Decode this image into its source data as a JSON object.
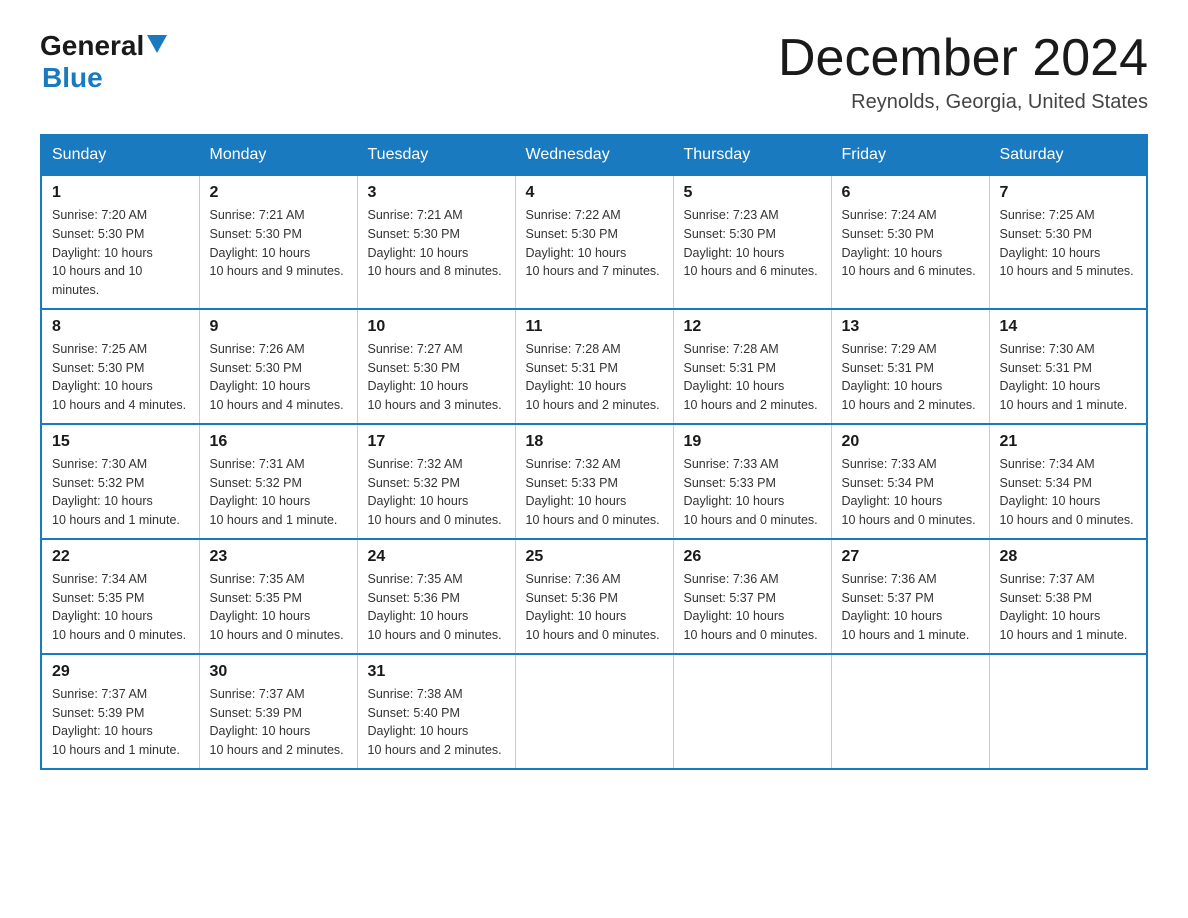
{
  "header": {
    "logo_general": "General",
    "logo_blue": "Blue",
    "month_title": "December 2024",
    "location": "Reynolds, Georgia, United States"
  },
  "days_of_week": [
    "Sunday",
    "Monday",
    "Tuesday",
    "Wednesday",
    "Thursday",
    "Friday",
    "Saturday"
  ],
  "weeks": [
    [
      {
        "num": "1",
        "sunrise": "7:20 AM",
        "sunset": "5:30 PM",
        "daylight": "10 hours and 10 minutes."
      },
      {
        "num": "2",
        "sunrise": "7:21 AM",
        "sunset": "5:30 PM",
        "daylight": "10 hours and 9 minutes."
      },
      {
        "num": "3",
        "sunrise": "7:21 AM",
        "sunset": "5:30 PM",
        "daylight": "10 hours and 8 minutes."
      },
      {
        "num": "4",
        "sunrise": "7:22 AM",
        "sunset": "5:30 PM",
        "daylight": "10 hours and 7 minutes."
      },
      {
        "num": "5",
        "sunrise": "7:23 AM",
        "sunset": "5:30 PM",
        "daylight": "10 hours and 6 minutes."
      },
      {
        "num": "6",
        "sunrise": "7:24 AM",
        "sunset": "5:30 PM",
        "daylight": "10 hours and 6 minutes."
      },
      {
        "num": "7",
        "sunrise": "7:25 AM",
        "sunset": "5:30 PM",
        "daylight": "10 hours and 5 minutes."
      }
    ],
    [
      {
        "num": "8",
        "sunrise": "7:25 AM",
        "sunset": "5:30 PM",
        "daylight": "10 hours and 4 minutes."
      },
      {
        "num": "9",
        "sunrise": "7:26 AM",
        "sunset": "5:30 PM",
        "daylight": "10 hours and 4 minutes."
      },
      {
        "num": "10",
        "sunrise": "7:27 AM",
        "sunset": "5:30 PM",
        "daylight": "10 hours and 3 minutes."
      },
      {
        "num": "11",
        "sunrise": "7:28 AM",
        "sunset": "5:31 PM",
        "daylight": "10 hours and 2 minutes."
      },
      {
        "num": "12",
        "sunrise": "7:28 AM",
        "sunset": "5:31 PM",
        "daylight": "10 hours and 2 minutes."
      },
      {
        "num": "13",
        "sunrise": "7:29 AM",
        "sunset": "5:31 PM",
        "daylight": "10 hours and 2 minutes."
      },
      {
        "num": "14",
        "sunrise": "7:30 AM",
        "sunset": "5:31 PM",
        "daylight": "10 hours and 1 minute."
      }
    ],
    [
      {
        "num": "15",
        "sunrise": "7:30 AM",
        "sunset": "5:32 PM",
        "daylight": "10 hours and 1 minute."
      },
      {
        "num": "16",
        "sunrise": "7:31 AM",
        "sunset": "5:32 PM",
        "daylight": "10 hours and 1 minute."
      },
      {
        "num": "17",
        "sunrise": "7:32 AM",
        "sunset": "5:32 PM",
        "daylight": "10 hours and 0 minutes."
      },
      {
        "num": "18",
        "sunrise": "7:32 AM",
        "sunset": "5:33 PM",
        "daylight": "10 hours and 0 minutes."
      },
      {
        "num": "19",
        "sunrise": "7:33 AM",
        "sunset": "5:33 PM",
        "daylight": "10 hours and 0 minutes."
      },
      {
        "num": "20",
        "sunrise": "7:33 AM",
        "sunset": "5:34 PM",
        "daylight": "10 hours and 0 minutes."
      },
      {
        "num": "21",
        "sunrise": "7:34 AM",
        "sunset": "5:34 PM",
        "daylight": "10 hours and 0 minutes."
      }
    ],
    [
      {
        "num": "22",
        "sunrise": "7:34 AM",
        "sunset": "5:35 PM",
        "daylight": "10 hours and 0 minutes."
      },
      {
        "num": "23",
        "sunrise": "7:35 AM",
        "sunset": "5:35 PM",
        "daylight": "10 hours and 0 minutes."
      },
      {
        "num": "24",
        "sunrise": "7:35 AM",
        "sunset": "5:36 PM",
        "daylight": "10 hours and 0 minutes."
      },
      {
        "num": "25",
        "sunrise": "7:36 AM",
        "sunset": "5:36 PM",
        "daylight": "10 hours and 0 minutes."
      },
      {
        "num": "26",
        "sunrise": "7:36 AM",
        "sunset": "5:37 PM",
        "daylight": "10 hours and 0 minutes."
      },
      {
        "num": "27",
        "sunrise": "7:36 AM",
        "sunset": "5:37 PM",
        "daylight": "10 hours and 1 minute."
      },
      {
        "num": "28",
        "sunrise": "7:37 AM",
        "sunset": "5:38 PM",
        "daylight": "10 hours and 1 minute."
      }
    ],
    [
      {
        "num": "29",
        "sunrise": "7:37 AM",
        "sunset": "5:39 PM",
        "daylight": "10 hours and 1 minute."
      },
      {
        "num": "30",
        "sunrise": "7:37 AM",
        "sunset": "5:39 PM",
        "daylight": "10 hours and 2 minutes."
      },
      {
        "num": "31",
        "sunrise": "7:38 AM",
        "sunset": "5:40 PM",
        "daylight": "10 hours and 2 minutes."
      },
      null,
      null,
      null,
      null
    ]
  ],
  "labels": {
    "sunrise": "Sunrise:",
    "sunset": "Sunset:",
    "daylight": "Daylight:"
  }
}
